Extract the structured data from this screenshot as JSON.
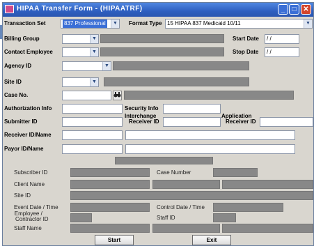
{
  "window": {
    "title": "HIPAA Transfer Form - (HIPAATRF)",
    "controls": {
      "minimize": "_",
      "maximize": "□",
      "close": "✕"
    }
  },
  "header": {
    "transaction_set_label": "Transaction Set",
    "transaction_set_value": "837 Professional",
    "format_type_label": "Format Type",
    "format_type_value": "15 HIPAA 837 Medicaid 10/11"
  },
  "form": {
    "billing_group": "Billing Group",
    "contact_employee": "Contact Employee",
    "agency_id": "Agency ID",
    "site_id": "Site ID",
    "case_no": "Case No.",
    "start_date_label": "Start Date",
    "start_date_value": "/ /",
    "stop_date_label": "Stop Date",
    "stop_date_value": "/ /",
    "authorization_info": "Authorization Info",
    "security_info": "Security Info",
    "submitter_id": "Submitter ID",
    "interchange_receiver_id_1": "Interchange",
    "interchange_receiver_id_2": "Receiver ID",
    "application_receiver_id_1": "Application",
    "application_receiver_id_2": "Receiver ID",
    "receiver_id_name": "Receiver ID/Name",
    "payor_id_name": "Payor ID/Name"
  },
  "details": {
    "subscriber_id": "Subscriber ID",
    "case_number": "Case Number",
    "client_name": "Client Name",
    "site_id": "Site ID",
    "event_date_time": "Event Date / Time",
    "control_date_time": "Control Date / Time",
    "employee_contractor_id_1": "Employee /",
    "employee_contractor_id_2": "Contractor ID",
    "staff_id": "Staff ID",
    "staff_name": "Staff Name"
  },
  "buttons": {
    "start": "Start",
    "exit": "Exit"
  },
  "icons": {
    "binoculars": "binoculars-icon"
  },
  "colors": {
    "titlebar": "#2e5fc0",
    "disabled_field": "#888888",
    "window_bg": "#d9d6cf"
  }
}
